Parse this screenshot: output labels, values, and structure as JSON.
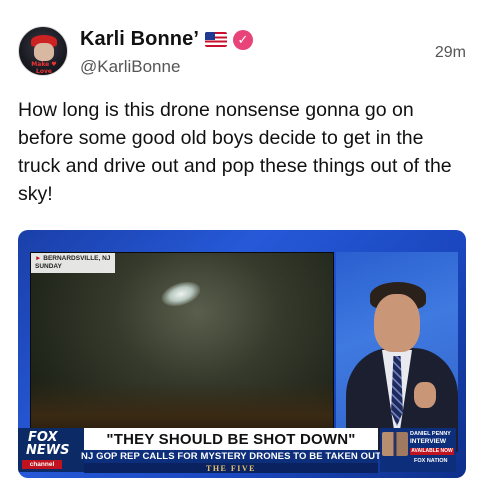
{
  "post": {
    "display_name": "Karli Bonne’",
    "handle": "@KarliBonne",
    "time": "29m",
    "avatar_label": "Make ♥ Love",
    "text": "How long is this drone nonsense gonna go on before some good old boys decide to get in the truck and drive out and pop these things out of the sky!",
    "icons": {
      "flag": "us-flag-icon",
      "verified": "verified-badge-icon"
    },
    "colors": {
      "verified": "#e8447a",
      "accent_blue": "#1f3a93"
    }
  },
  "media": {
    "location_line1": "BERNARDSVILLE, NJ",
    "location_line2": "SUNDAY",
    "logo_fox": "FOX",
    "logo_news": "NEWS",
    "logo_channel": "channel",
    "headline": "\"THEY SHOULD BE SHOT DOWN\"",
    "subhead": "NJ GOP REP CALLS FOR MYSTERY DRONES TO BE TAKEN OUT",
    "show_name": "THE FIVE",
    "promo_line1": "DANIEL PENNY",
    "promo_line2": "INTERVIEW",
    "promo_available": "AVAILABLE NOW",
    "promo_network": "FOX NATION"
  }
}
